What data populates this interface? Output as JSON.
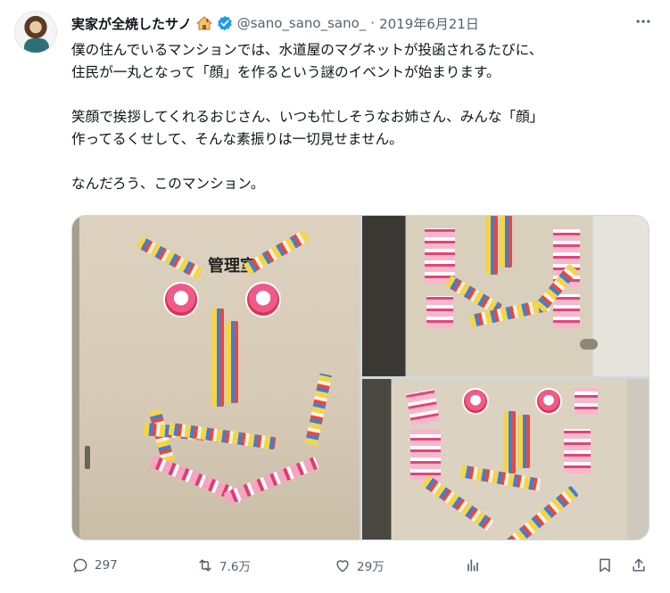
{
  "tweet": {
    "name": "実家が全焼したサノ",
    "handle": "@sano_sano_sano_",
    "separator": "·",
    "date": "2019年6月21日",
    "lines": [
      "僕の住んでいるマンションでは、水道屋のマグネットが投函されるたびに、",
      "住民が一丸となって「顔」を作るという謎のイベントが始まります。",
      "",
      "笑顔で挨拶してくれるおじさん、いつも忙しそうなお姉さん、みんな「顔」",
      "作ってるくせして、そんな素振りは一切見せません。",
      "",
      "なんだろう、このマンション。"
    ],
    "door_label": "管理室"
  },
  "actions": {
    "replies": "297",
    "retweets": "7.6万",
    "likes": "29万"
  },
  "icons": {
    "name_badge": "house-emoji-icon",
    "verified": "verified-badge-icon",
    "more": "more-icon",
    "reply": "reply-icon",
    "retweet": "retweet-icon",
    "like": "heart-icon",
    "analytics": "analytics-icon",
    "bookmark": "bookmark-icon",
    "share": "share-icon"
  },
  "colors": {
    "text": "#0f1419",
    "secondary": "#536471",
    "verified": "#1d9bf0"
  }
}
